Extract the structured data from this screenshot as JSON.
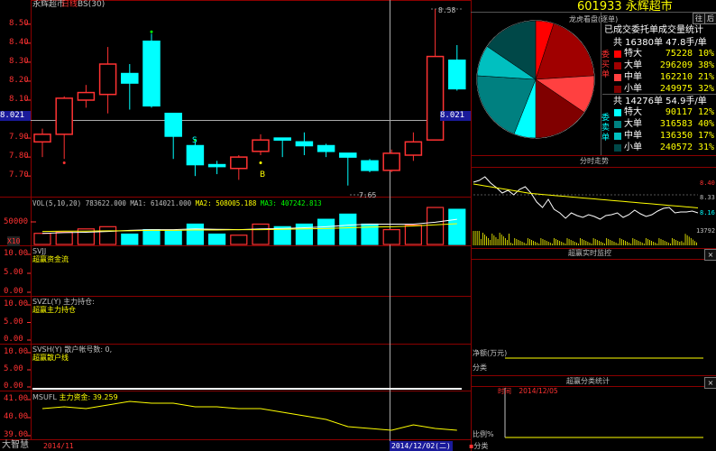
{
  "colors": {
    "up": "#ff3232",
    "down": "#00ffff",
    "axis_text": "#ff3232",
    "grid": "#8b0000",
    "yellow": "#ffff00",
    "white": "#ffffff",
    "dark_red": "#a00000",
    "teal": "#008080"
  },
  "kchart": {
    "stock_label": "永辉超市",
    "period_label": "日线",
    "indicator_label": "BS(30)",
    "price_ticks": [
      "8.50",
      "8.40",
      "8.30",
      "8.20",
      "8.10",
      "8.00",
      "7.90",
      "7.80",
      "7.70"
    ],
    "cursor_price_left": "8.021",
    "cursor_price_right": "8.021",
    "high_marker": "8.58",
    "low_marker": "7.65",
    "signal_s": "S",
    "signal_b": "B"
  },
  "volume": {
    "legend_vol": "VOL(5,10,20)",
    "legend_vol_value": "783622.000",
    "legend_ma1": "MA1: 614021.000",
    "legend_ma2": "MA2: 508005.188",
    "legend_ma3": "MA3: 407242.813",
    "tick": "50000",
    "unit": "X10"
  },
  "panels": [
    {
      "legend": "SVJJ",
      "sublegend": "超赢资金流",
      "ticks": [
        "10.00",
        "5.00",
        "0.00"
      ]
    },
    {
      "legend": "SVZL(Y)  主力持仓:",
      "sublegend": "超赢主力持仓",
      "ticks": [
        "10.00",
        "5.00",
        "0.00"
      ]
    },
    {
      "legend": "SVSH(Y)  散户帐号数: 0,",
      "sublegend": "超赢散户线",
      "ticks": [
        "10.00",
        "5.00",
        "0.00"
      ]
    }
  ],
  "main_funds": {
    "legend": "MSUFL",
    "legend_label": "主力资金:",
    "legend_value": "39.259",
    "ticks": [
      "41.00",
      "40.00",
      "39.00"
    ]
  },
  "bottom_bar": {
    "app_name": "大智慧",
    "date_left": "2014/11",
    "date_cursor": "2014/12/02(二)"
  },
  "right": {
    "code": "601933",
    "name": "永辉超市",
    "btn_prev": "往",
    "btn_next": "后",
    "dragon_tiger": "龙虎看盘(逐单)",
    "stats_title": "已成交委托单成交量统计",
    "buy": {
      "side_label": "委买单",
      "summary": "共 16380单 47.8手/单",
      "rows": [
        {
          "label": "特大",
          "value": "75228",
          "pct": "10%",
          "color": "#ff0000"
        },
        {
          "label": "大单",
          "value": "296209",
          "pct": "38%",
          "color": "#a00000"
        },
        {
          "label": "中单",
          "value": "162210",
          "pct": "21%",
          "color": "#ff4040"
        },
        {
          "label": "小单",
          "value": "249975",
          "pct": "32%",
          "color": "#800000"
        }
      ]
    },
    "sell": {
      "side_label": "委卖单",
      "summary": "共 14276单 54.9手/单",
      "rows": [
        {
          "label": "特大",
          "value": "90117",
          "pct": "12%",
          "color": "#00ffff"
        },
        {
          "label": "大单",
          "value": "316583",
          "pct": "40%",
          "color": "#008080"
        },
        {
          "label": "中单",
          "value": "136350",
          "pct": "17%",
          "color": "#00c0c0"
        },
        {
          "label": "小单",
          "value": "240572",
          "pct": "31%",
          "color": "#004848"
        }
      ]
    },
    "intraday": {
      "title": "分时走势",
      "price_high": "8.40",
      "price_mid": "8.33",
      "price_low": "8.16",
      "volume_max": "13792"
    },
    "monitor": {
      "title": "超赢实时监控",
      "net_label": "净额(万元)",
      "category_label": "分类"
    },
    "stats": {
      "title": "超赢分类统计",
      "time_label": "时间",
      "time_value": "2014/12/05",
      "ratio_label": "比例%",
      "category_label": "分类"
    }
  },
  "chart_data": {
    "type": "candlestick",
    "ylim": [
      7.62,
      8.58
    ],
    "candles": [
      {
        "open": 7.88,
        "close": 7.92,
        "high": 7.95,
        "low": 7.8,
        "vol": 0.3
      },
      {
        "open": 7.92,
        "close": 8.11,
        "high": 8.12,
        "low": 7.79,
        "vol": 0.33
      },
      {
        "open": 8.1,
        "close": 8.14,
        "high": 8.18,
        "low": 8.06,
        "vol": 0.42
      },
      {
        "open": 8.13,
        "close": 8.29,
        "high": 8.38,
        "low": 8.03,
        "vol": 0.48
      },
      {
        "open": 8.24,
        "close": 8.19,
        "high": 8.29,
        "low": 8.05,
        "vol": 0.28
      },
      {
        "open": 8.41,
        "close": 8.07,
        "high": 8.45,
        "low": 8.06,
        "vol": 0.4
      },
      {
        "open": 8.03,
        "close": 7.91,
        "high": 8.03,
        "low": 7.79,
        "vol": 0.36
      },
      {
        "open": 7.86,
        "close": 7.76,
        "high": 7.88,
        "low": 7.7,
        "vol": 0.55
      },
      {
        "open": 7.76,
        "close": 7.75,
        "high": 7.78,
        "low": 7.71,
        "vol": 0.28
      },
      {
        "open": 7.74,
        "close": 7.8,
        "high": 7.81,
        "low": 7.68,
        "vol": 0.25
      },
      {
        "open": 7.83,
        "close": 7.89,
        "high": 7.92,
        "low": 7.81,
        "vol": 0.55
      },
      {
        "open": 7.9,
        "close": 7.89,
        "high": 7.9,
        "low": 7.8,
        "vol": 0.48
      },
      {
        "open": 7.88,
        "close": 7.86,
        "high": 7.93,
        "low": 7.81,
        "vol": 0.55
      },
      {
        "open": 7.86,
        "close": 7.83,
        "high": 7.87,
        "low": 7.8,
        "vol": 0.68
      },
      {
        "open": 7.82,
        "close": 7.8,
        "high": 7.82,
        "low": 7.65,
        "vol": 0.82
      },
      {
        "open": 7.78,
        "close": 7.73,
        "high": 7.79,
        "low": 7.72,
        "vol": 0.55
      },
      {
        "open": 7.73,
        "close": 7.82,
        "high": 7.84,
        "low": 7.72,
        "vol": 0.4
      },
      {
        "open": 7.81,
        "close": 7.88,
        "high": 7.93,
        "low": 7.78,
        "vol": 0.52
      },
      {
        "open": 7.89,
        "close": 8.33,
        "high": 8.58,
        "low": 7.89,
        "vol": 1.0
      },
      {
        "open": 8.31,
        "close": 8.16,
        "high": 8.39,
        "low": 8.15,
        "vol": 0.95
      }
    ],
    "ma_lines": [
      [
        0.3,
        0.32,
        0.33,
        0.35,
        0.38,
        0.4,
        0.4,
        0.42,
        0.41,
        0.4,
        0.42,
        0.43,
        0.45,
        0.48,
        0.52,
        0.55,
        0.55,
        0.55,
        0.6,
        0.68
      ],
      [
        0.35,
        0.36,
        0.36,
        0.37,
        0.37,
        0.38,
        0.38,
        0.39,
        0.39,
        0.4,
        0.4,
        0.41,
        0.42,
        0.43,
        0.45,
        0.47,
        0.48,
        0.5,
        0.53,
        0.56
      ]
    ],
    "main_funds": [
      40.5,
      40.6,
      40.5,
      40.7,
      40.9,
      40.8,
      40.8,
      40.6,
      40.6,
      40.5,
      40.5,
      40.3,
      40.1,
      39.9,
      39.5,
      39.4,
      39.3,
      39.6,
      39.4,
      39.3
    ],
    "main_funds_ylim": [
      38.8,
      41.3
    ],
    "buy_pie": [
      10,
      38,
      21,
      32
    ],
    "sell_pie": [
      12,
      40,
      17,
      31
    ]
  }
}
